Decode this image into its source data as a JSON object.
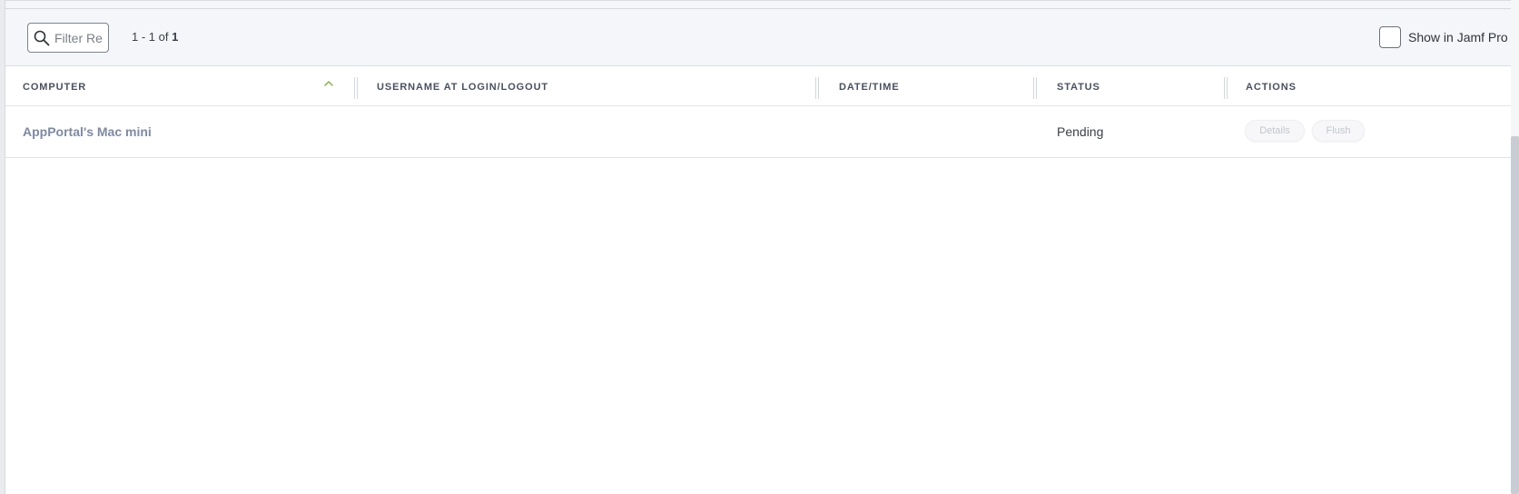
{
  "toolbar": {
    "filter_placeholder": "Filter Re",
    "pagination_range": "1 - 1 of",
    "pagination_total": "1",
    "show_in_label": "Show in Jamf Pro D"
  },
  "table": {
    "columns": {
      "computer": "COMPUTER",
      "username": "USERNAME AT LOGIN/LOGOUT",
      "datetime": "DATE/TIME",
      "status": "STATUS",
      "actions": "ACTIONS"
    },
    "sort": {
      "column": "computer",
      "direction": "ascending"
    },
    "rows": [
      {
        "computer": "AppPortal's Mac mini",
        "username": "",
        "datetime": "",
        "status": "Pending",
        "actions": {
          "details": "Details",
          "flush": "Flush"
        }
      }
    ]
  },
  "icons": [
    "search-icon",
    "sort-ascending-icon"
  ],
  "colors": {
    "toolbar_bg": "#f5f6f9",
    "link": "#7d8aa3",
    "header_text": "#4a5060",
    "sort_accent": "#8ab04a"
  }
}
